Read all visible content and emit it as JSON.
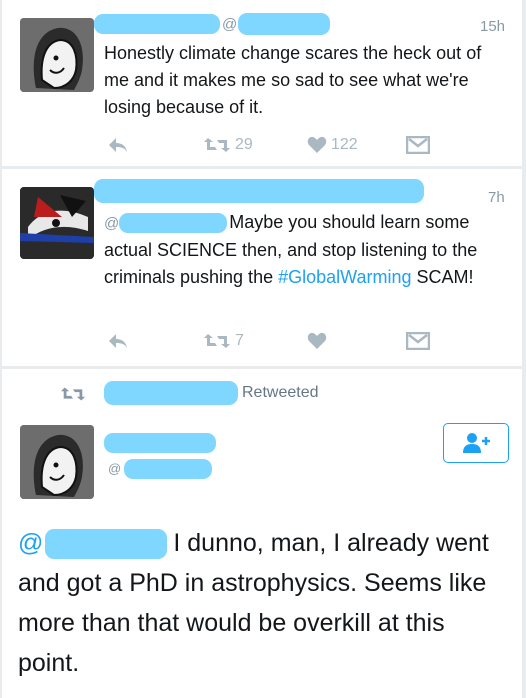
{
  "tweets": [
    {
      "handle_at": "@",
      "time": "15h",
      "text": "Honestly climate change scares the heck out of me and it makes me so sad to see what we're losing because of it.",
      "retweets": "29",
      "likes": "122"
    },
    {
      "time": "7h",
      "mention_at": "@",
      "text_a": "Maybe you should learn",
      "text_b": "some actual SCIENCE then, and stop listening to the criminals pushing the",
      "hashtag": "#GlobalWarming",
      "text_c": "SCAM!",
      "retweets": "7"
    },
    {
      "retweeted_label": "Retweeted",
      "handle_at": "@",
      "mention_at": "@",
      "text_a": "I dunno, man, I already",
      "text_b": "went and got a PhD in astrophysics. Seems like more than that would be overkill at this point."
    }
  ],
  "colors": {
    "redaction": "#7fd6ff",
    "link": "#1da1f2",
    "muted": "#aab8c2"
  },
  "icons": [
    "reply-icon",
    "retweet-icon",
    "like-icon",
    "message-icon",
    "follow-icon"
  ]
}
